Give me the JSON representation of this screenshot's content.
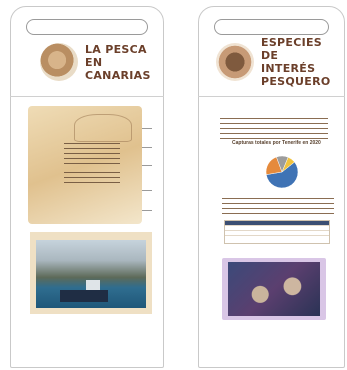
{
  "panels": [
    {
      "title_line1": "LA PESCA",
      "title_line2": "EN CANARIAS"
    },
    {
      "title_line1": "ESPECIES DE",
      "title_line2": "INTERÉS PESQUERO",
      "chart_title": "Capturas totales por Tenerife en 2020"
    }
  ],
  "chart_data": {
    "type": "pie",
    "title": "Capturas totales por Tenerife en 2020",
    "slices": [
      {
        "value": 0.58,
        "color": "#3f73b5"
      },
      {
        "value": 0.22,
        "color": "#e58a3c"
      },
      {
        "value": 0.12,
        "color": "#9c9c9c"
      },
      {
        "value": 0.08,
        "color": "#f0c23e"
      }
    ]
  }
}
